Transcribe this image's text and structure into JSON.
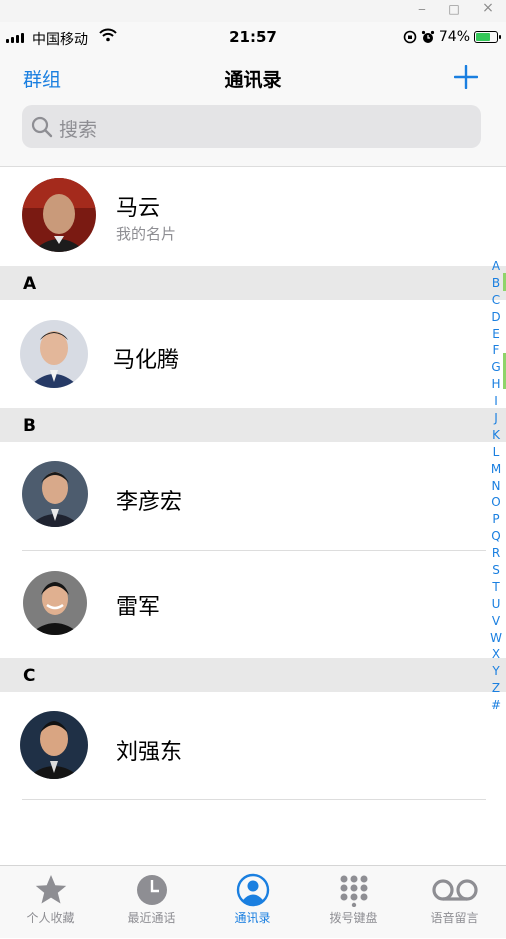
{
  "window": {
    "minimize_glyph": "‒",
    "maximize_glyph": "□",
    "close_glyph": "×"
  },
  "status_bar": {
    "carrier": "中国移动",
    "time": "21:57",
    "battery_percent": "74%",
    "battery_level": 0.74,
    "icons": [
      "signal-icon",
      "wifi-icon",
      "orientation-lock-icon",
      "alarm-icon",
      "battery-icon"
    ]
  },
  "nav": {
    "left_label": "群组",
    "title": "通讯录",
    "add_icon": "plus-icon"
  },
  "search": {
    "placeholder": "搜索",
    "icon": "search-icon"
  },
  "my_card": {
    "name": "马云",
    "subtitle": "我的名片"
  },
  "sections": [
    {
      "letter": "A",
      "contacts": [
        {
          "name": "马化腾"
        }
      ]
    },
    {
      "letter": "B",
      "contacts": [
        {
          "name": "李彦宏"
        },
        {
          "name": "雷军"
        }
      ]
    },
    {
      "letter": "C",
      "contacts": [
        {
          "name": "刘强东"
        }
      ]
    }
  ],
  "index_letters": [
    "A",
    "B",
    "C",
    "D",
    "E",
    "F",
    "G",
    "H",
    "I",
    "J",
    "K",
    "L",
    "M",
    "N",
    "O",
    "P",
    "Q",
    "R",
    "S",
    "T",
    "U",
    "V",
    "W",
    "X",
    "Y",
    "Z",
    "#"
  ],
  "tabs": [
    {
      "label": "个人收藏",
      "icon": "star-icon",
      "active": false
    },
    {
      "label": "最近通话",
      "icon": "clock-icon",
      "active": false
    },
    {
      "label": "通讯录",
      "icon": "contacts-icon",
      "active": true
    },
    {
      "label": "拨号键盘",
      "icon": "keypad-icon",
      "active": false
    },
    {
      "label": "语音留言",
      "icon": "voicemail-icon",
      "active": false
    }
  ],
  "colors": {
    "accent": "#1a7fe0",
    "inactive": "#8e8e93",
    "section_bg": "#e8e8e8",
    "battery_fill": "#34c759"
  }
}
